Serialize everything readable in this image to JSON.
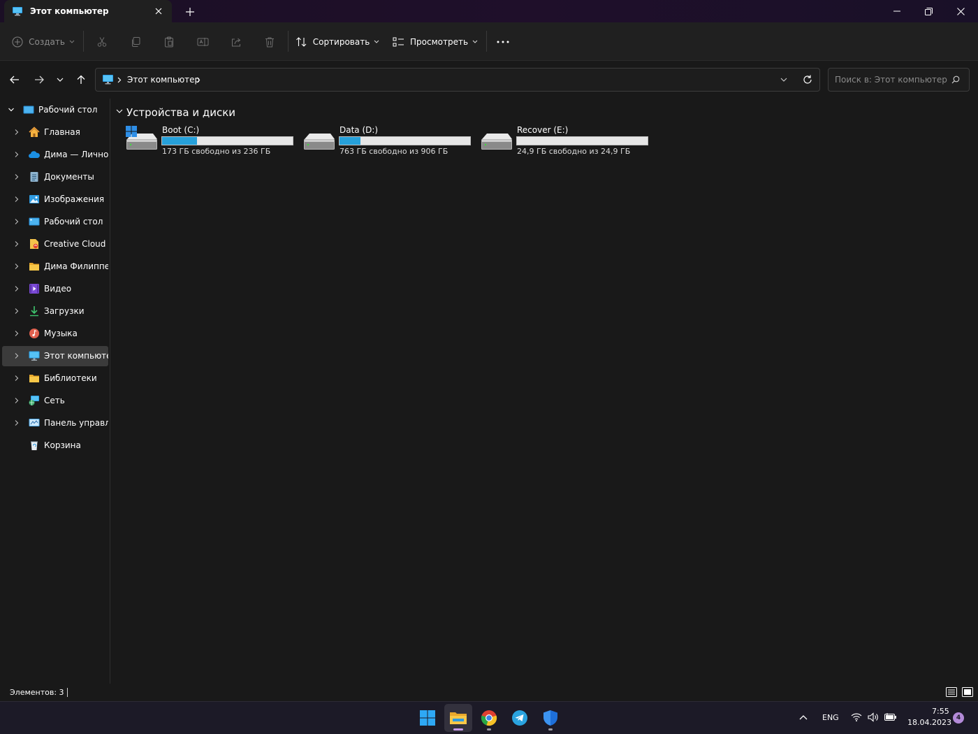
{
  "window": {
    "tab_title": "Этот компьютер",
    "tab_icon": "this-pc-icon",
    "new_tab_icon": "plus-icon",
    "controls": [
      "minimize-icon",
      "maximize-icon",
      "close-icon"
    ]
  },
  "toolbar": {
    "create_label": "Создать",
    "sort_label": "Сортировать",
    "view_label": "Просмотреть",
    "icons": [
      "cut-icon",
      "copy-icon",
      "paste-icon",
      "rename-icon",
      "share-icon",
      "delete-icon",
      "more-icon"
    ]
  },
  "address": {
    "crumb": "Этот компьютер",
    "search_placeholder": "Поиск в: Этот компьютер"
  },
  "sidebar": {
    "items": [
      {
        "label": "Рабочий стол",
        "icon": "desktop-folder-icon",
        "expanded": true
      },
      {
        "label": "Главная",
        "icon": "home-icon"
      },
      {
        "label": "Дима — Личное",
        "icon": "onedrive-icon"
      },
      {
        "label": "Документы",
        "icon": "documents-icon"
      },
      {
        "label": "Изображения",
        "icon": "pictures-icon"
      },
      {
        "label": "Рабочий стол",
        "icon": "desktop-icon"
      },
      {
        "label": "Creative Cloud Files",
        "icon": "creative-cloud-icon"
      },
      {
        "label": "Дима Филиппенко",
        "icon": "user-folder-icon"
      },
      {
        "label": "Видео",
        "icon": "videos-icon"
      },
      {
        "label": "Загрузки",
        "icon": "downloads-icon"
      },
      {
        "label": "Музыка",
        "icon": "music-icon"
      },
      {
        "label": "Этот компьютер",
        "icon": "this-pc-icon",
        "selected": true
      },
      {
        "label": "Библиотеки",
        "icon": "libraries-icon"
      },
      {
        "label": "Сеть",
        "icon": "network-icon"
      },
      {
        "label": "Панель управления",
        "icon": "control-panel-icon"
      },
      {
        "label": "Корзина",
        "icon": "recycle-bin-icon",
        "no_chevron": true
      }
    ]
  },
  "main": {
    "group_title": "Устройства и диски",
    "drives": [
      {
        "name": "Boot (C:)",
        "space": "173 ГБ свободно из 236 ГБ",
        "used_fraction": 0.267,
        "icon": "windows-drive-icon"
      },
      {
        "name": "Data (D:)",
        "space": "763 ГБ свободно из 906 ГБ",
        "used_fraction": 0.158,
        "icon": "hard-drive-icon"
      },
      {
        "name": "Recover (E:)",
        "space": "24,9 ГБ свободно из 24,9 ГБ",
        "used_fraction": 0.0,
        "icon": "hard-drive-icon"
      }
    ]
  },
  "status": {
    "items_text": "Элементов: 3"
  },
  "taskbar": {
    "apps": [
      "windows-start-icon",
      "file-explorer-icon",
      "chrome-icon",
      "telegram-icon",
      "defender-icon"
    ],
    "language": "ENG",
    "time": "7:55",
    "date": "18.04.2023",
    "notification_count": "4"
  },
  "colors": {
    "accent": "#26a0da",
    "background": "#191919",
    "chrome": "#202020",
    "selected": "#3b3b3b"
  }
}
